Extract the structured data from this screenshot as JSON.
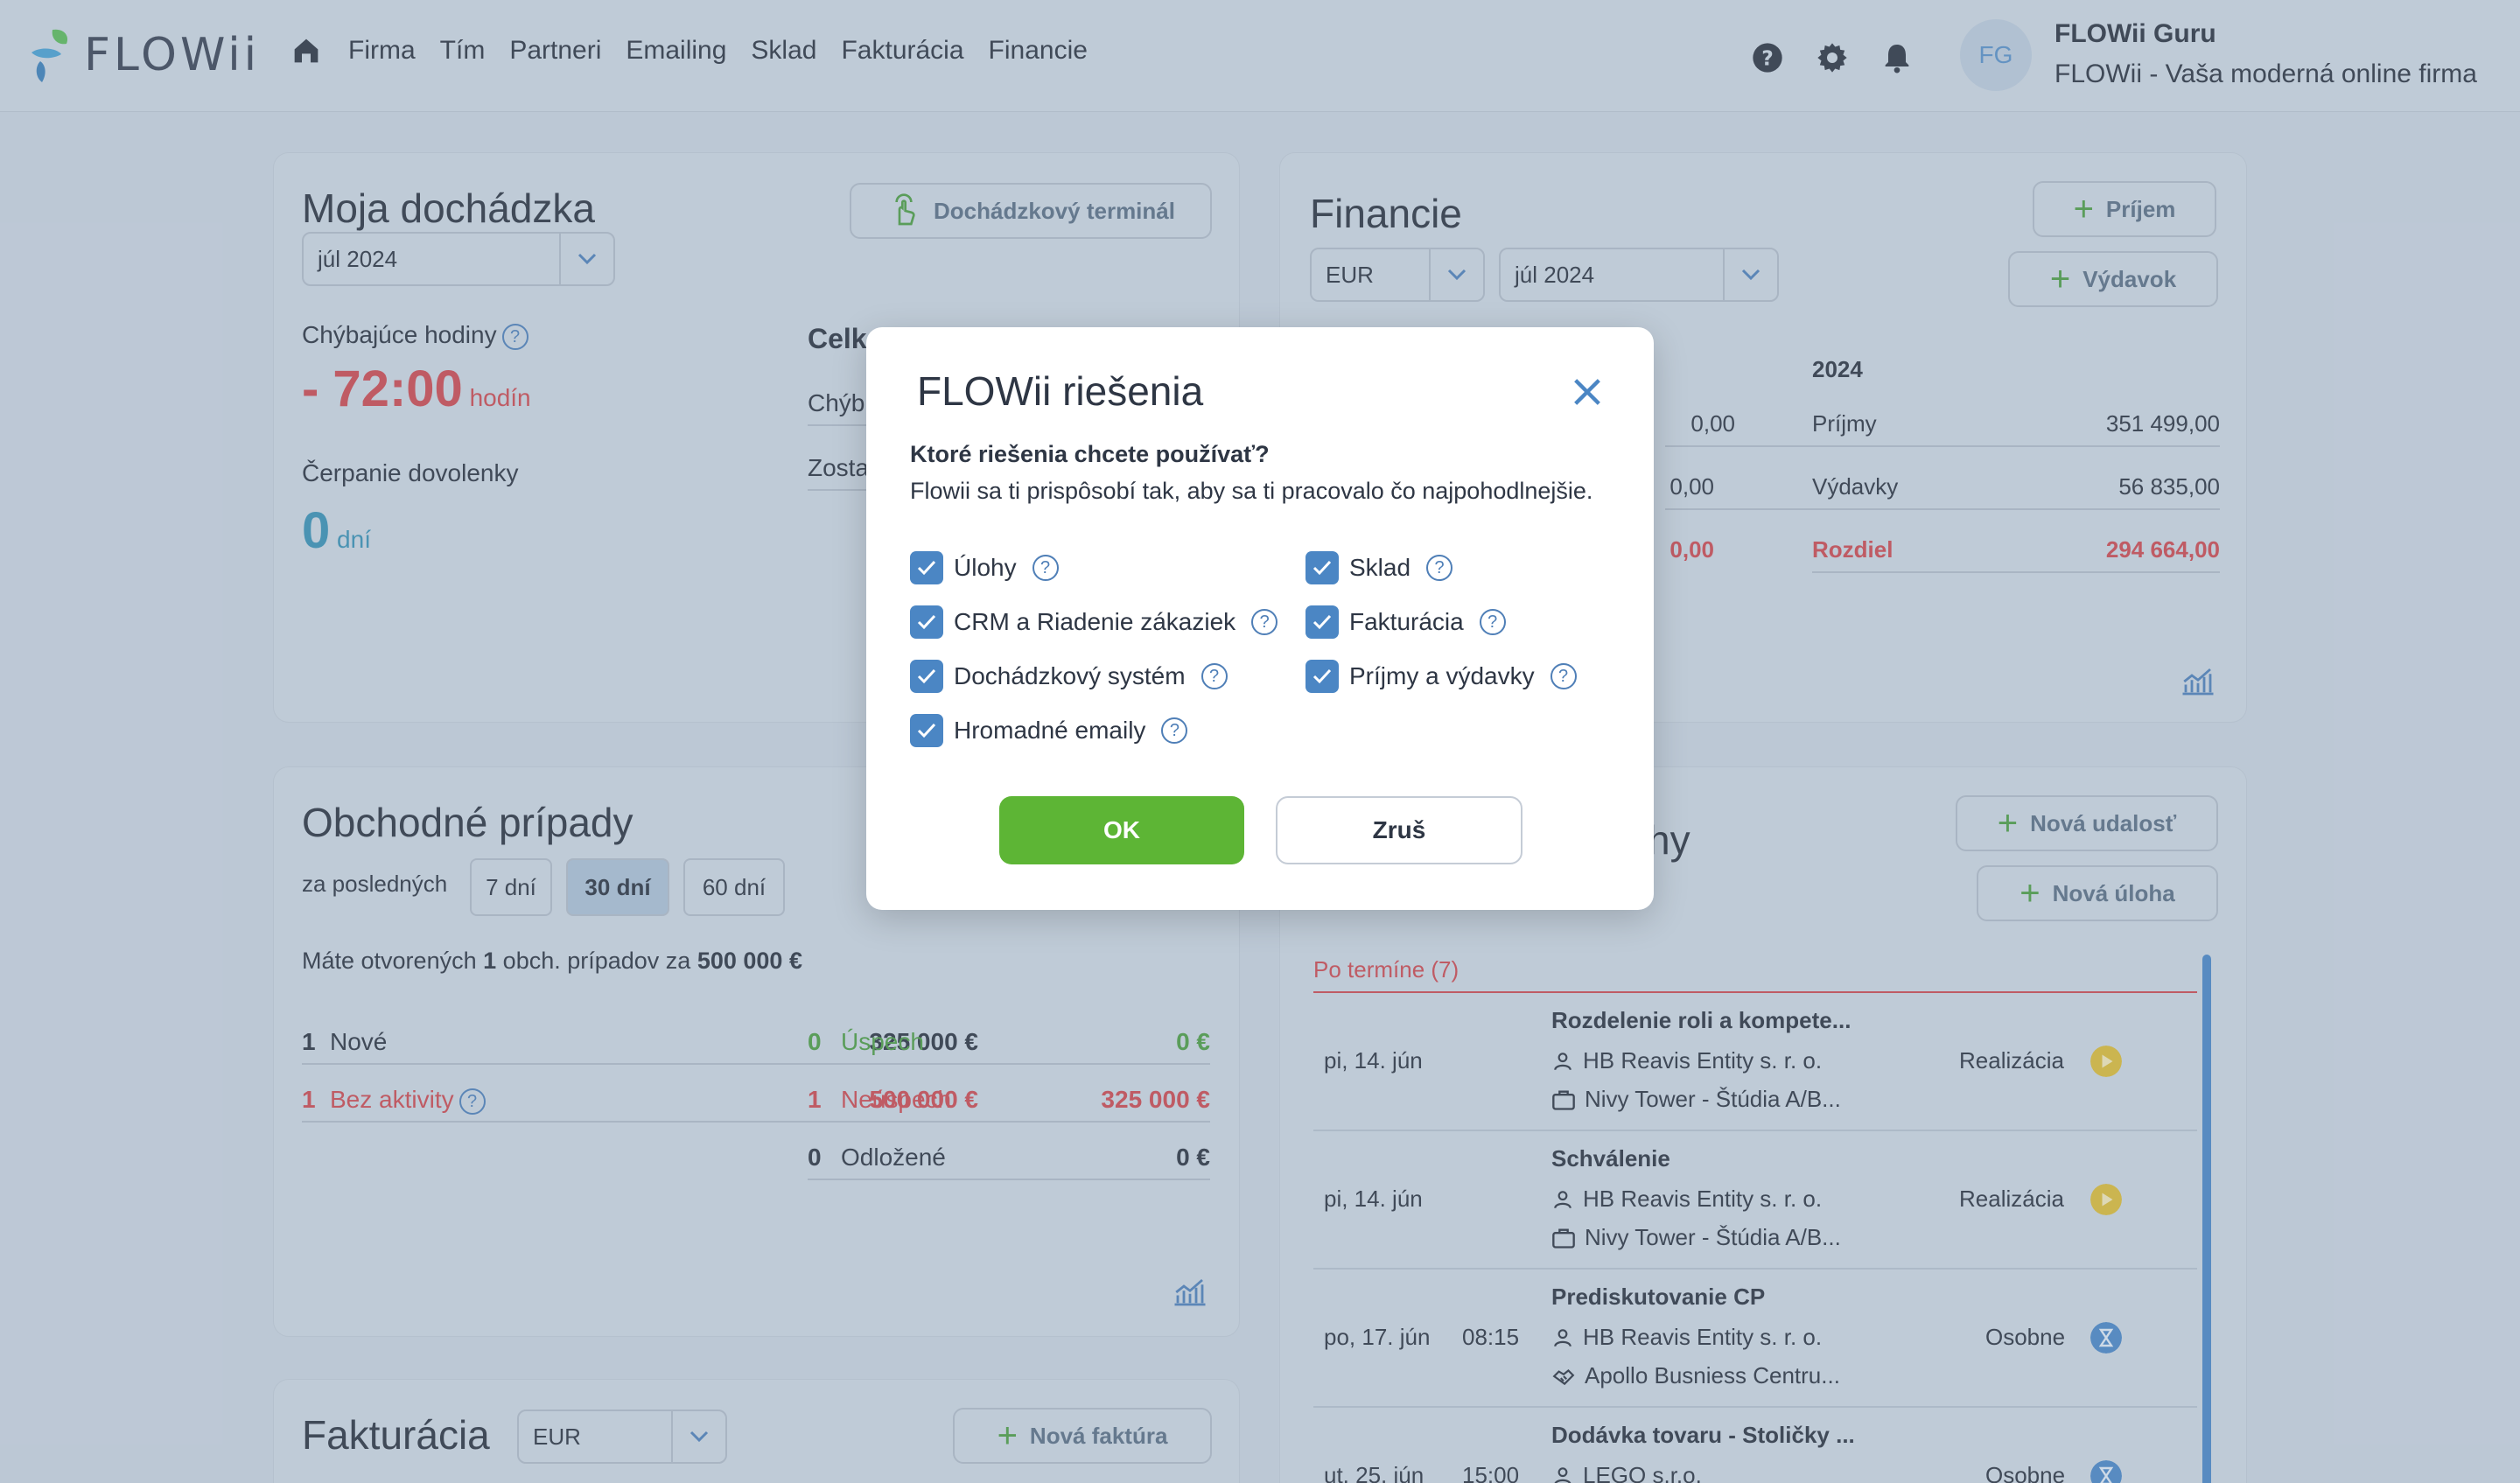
{
  "app": {
    "logo_text": "FLOWii",
    "nav": [
      "Firma",
      "Tím",
      "Partneri",
      "Emailing",
      "Sklad",
      "Fakturácia",
      "Financie"
    ],
    "avatar_initials": "FG",
    "user_name": "FLOWii Guru",
    "company": "FLOWii - Vaša moderná online firma"
  },
  "attendance": {
    "title": "Moja dochádzka",
    "period": "júl 2024",
    "terminal_button": "Dochádzkový terminál",
    "missing_hours_label": "Chýbajúce hodiny",
    "missing_hours_value": "- 72:00",
    "missing_hours_unit": "hodín",
    "vacation_label": "Čerpanie dovolenky",
    "vacation_value": "0",
    "vacation_unit": "dní",
    "right_title": "Celk",
    "right_row1": "Chýb",
    "right_row2": "Zosta"
  },
  "finance": {
    "title": "Financie",
    "currency": "EUR",
    "period": "júl 2024",
    "income_button": "Príjem",
    "expense_button": "Výdavok",
    "year": "2024",
    "month_values": [
      "0,00",
      "0,00",
      "0,00"
    ],
    "rows": [
      {
        "label": "Príjmy",
        "value": "351 499,00"
      },
      {
        "label": "Výdavky",
        "value": "56 835,00"
      },
      {
        "label": "Rozdiel",
        "value": "294 664,00"
      }
    ]
  },
  "deals": {
    "title": "Obchodné prípady",
    "range_label": "za posledných",
    "ranges": [
      "7 dní",
      "30 dní",
      "60 dní"
    ],
    "summary_prefix": "Máte otvorených",
    "summary_count": "1",
    "summary_middle": "obch. prípadov za",
    "summary_amount": "500 000 €",
    "left": [
      {
        "count": "1",
        "label": "Nové",
        "amount": "325 000 €"
      },
      {
        "count": "1",
        "label": "Bez aktivity",
        "amount": "500 000 €"
      }
    ],
    "right": [
      {
        "count": "0",
        "label": "Úspech",
        "amount": "0 €"
      },
      {
        "count": "1",
        "label": "Neúspech",
        "amount": "325 000 €"
      },
      {
        "count": "0",
        "label": "Odložené",
        "amount": "0 €"
      }
    ]
  },
  "tasks": {
    "title_tail": "hy",
    "new_event_button": "Nová udalosť",
    "new_task_button": "Nová úloha",
    "overdue_label": "Po termíne (7)",
    "events": [
      {
        "date": "pi, 14. jún",
        "time": "",
        "title": "Rozdelenie roli a kompete...",
        "partner": "HB Reavis Entity s. r. o.",
        "project": "Nivy Tower - Štúdia A/B...",
        "status": "Realizácia"
      },
      {
        "date": "pi, 14. jún",
        "time": "",
        "title": "Schválenie",
        "partner": "HB Reavis Entity s. r. o.",
        "project": "Nivy Tower - Štúdia A/B...",
        "status": "Realizácia"
      },
      {
        "date": "po, 17. jún",
        "time": "08:15",
        "title": "Prediskutovanie CP",
        "partner": "HB Reavis Entity s. r. o.",
        "project": "Apollo Busniess Centru...",
        "status": "Osobne"
      },
      {
        "date": "ut, 25. jún",
        "time": "15:00",
        "title": "Dodávka tovaru - Stoličky ...",
        "partner": "LEGO s.r.o.",
        "project": "",
        "status": "Osobne"
      }
    ]
  },
  "invoicing": {
    "title": "Fakturácia",
    "currency": "EUR",
    "new_invoice_button": "Nová faktúra"
  },
  "modal": {
    "title": "FLOWii riešenia",
    "question": "Ktoré riešenia chcete používať?",
    "subtitle": "Flowii sa ti prispôsobí tak, aby sa ti pracovalo čo najpohodlnejšie.",
    "options_left": [
      "Úlohy",
      "CRM a Riadenie zákaziek",
      "Dochádzkový systém",
      "Hromadné emaily"
    ],
    "options_right": [
      "Sklad",
      "Fakturácia",
      "Príjmy a výdavky"
    ],
    "ok_label": "OK",
    "cancel_label": "Zruš"
  },
  "colors": {
    "accent_blue": "#4b86c4",
    "ok_green": "#5db535",
    "negative_red": "#c94b52"
  }
}
